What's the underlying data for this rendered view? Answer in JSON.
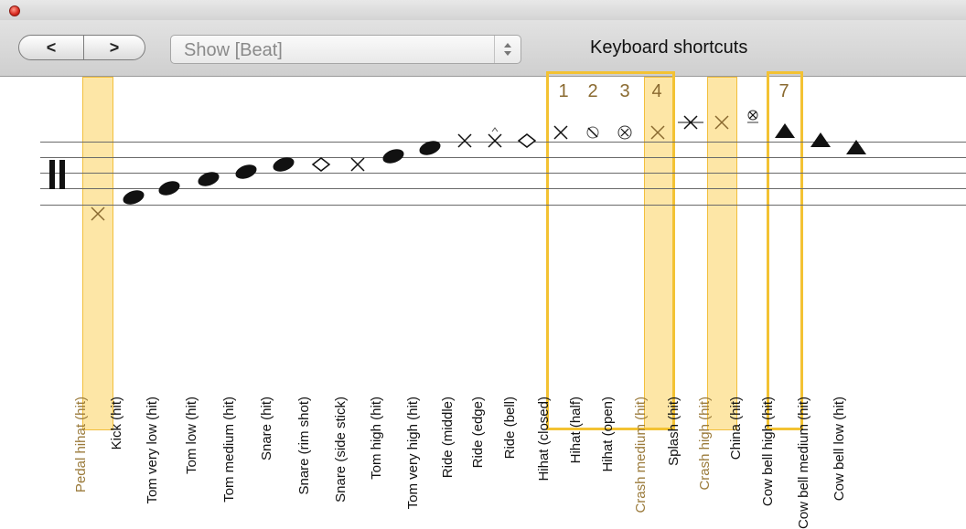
{
  "window": {
    "close_icon": "close-dot-icon"
  },
  "toolbar": {
    "prev_label": "<",
    "next_label": ">",
    "select_value": "Show [Beat]",
    "shortcuts_title": "Keyboard shortcuts"
  },
  "shortcut_numbers": [
    "1",
    "2",
    "3",
    "4",
    "7"
  ],
  "instruments": [
    "Pedal hihat (hit)",
    "Kick (hit)",
    "Tom very low  (hit)",
    "Tom low  (hit)",
    "Tom medium (hit)",
    "Snare (hit)",
    "Snare (rim shot)",
    "Snare (side stick)",
    "Tom high (hit)",
    "Tom very high (hit)",
    "Ride (middle)",
    "Ride (edge)",
    "Ride (bell)",
    "Hihat (closed)",
    "Hihat (half)",
    "Hihat (open)",
    "Crash medium (hit)",
    "Splash (hit)",
    "Crash high (hit)",
    "China (hit)",
    "Cow bell high (hit)",
    "Cow bell medium (hit)",
    "Cow bell low  (hit)"
  ],
  "note_heads": [
    "x-head",
    "filled-oval",
    "filled-oval",
    "filled-oval",
    "filled-oval",
    "filled-oval",
    "open-diamond",
    "x-head",
    "filled-oval",
    "filled-oval",
    "x-head",
    "x-accent",
    "open-diamond",
    "x-head",
    "slashed-circle",
    "circled-x",
    "x-head",
    "x-head",
    "x-head",
    "circled-x-accent",
    "filled-triangle",
    "filled-triangle",
    "filled-triangle"
  ],
  "colors": {
    "highlight_fill": "#fde6a6",
    "highlight_border": "#f3c233",
    "number_color": "#8a6a30"
  }
}
